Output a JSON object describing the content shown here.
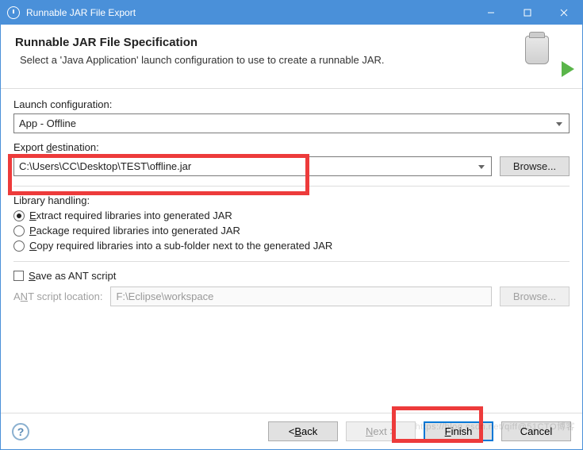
{
  "titlebar": {
    "title": "Runnable JAR File Export"
  },
  "header": {
    "title": "Runnable JAR File Specification",
    "desc": "Select a 'Java Application' launch configuration to use to create a runnable JAR."
  },
  "launch": {
    "label": "Launch configuration:",
    "value": "App - Offline"
  },
  "export": {
    "label": "Export destination:",
    "value": "C:\\Users\\CC\\Desktop\\TEST\\offline.jar",
    "browse": "Browse..."
  },
  "library": {
    "label": "Library handling:",
    "opt1": "Extract required libraries into generated JAR",
    "opt2": "Package required libraries into generated JAR",
    "opt3": "Copy required libraries into a sub-folder next to the generated JAR"
  },
  "ant": {
    "save_label": "Save as ANT script",
    "loc_label": "ANT script location:",
    "loc_value": "F:\\Eclipse\\workspace",
    "browse": "Browse..."
  },
  "footer": {
    "back": "< Back",
    "next": "Next >",
    "finish": "Finish",
    "cancel": "Cancel"
  },
  "watermark": "https://blog.csdn.net/qiff@51CTO博客"
}
